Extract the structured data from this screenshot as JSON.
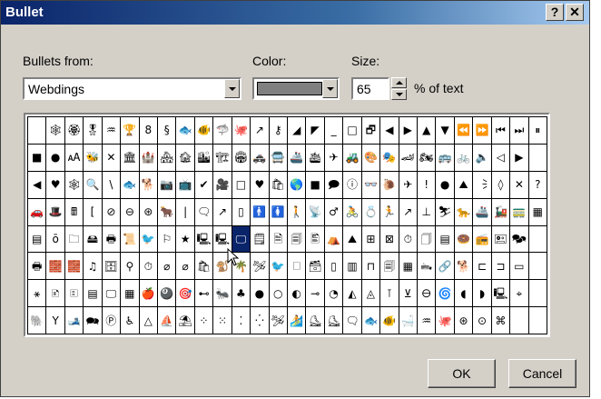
{
  "window": {
    "title": "Bullet",
    "help_label": "?",
    "close_label": "✕"
  },
  "bullets_from": {
    "label": "Bullets from:",
    "value": "Webdings"
  },
  "color": {
    "label": "Color:",
    "value": "#808080"
  },
  "size": {
    "label": "Size:",
    "value": "65",
    "suffix": "% of text"
  },
  "grid": {
    "selected_row": 4,
    "selected_col": 11,
    "rows": [
      [
        "",
        "🕸",
        "🏵",
        "🎖",
        "♒",
        "🏆",
        "8",
        "§",
        "🐟",
        "🐠",
        "🦈",
        "🐙",
        "↗",
        "⚷",
        "◢",
        "◤",
        "_",
        "□",
        "🗗",
        "◀",
        "▶",
        "▲",
        "▼",
        "⏪",
        "⏩",
        "⏮",
        "⏭",
        "⏸"
      ],
      [
        "■",
        "●",
        "🗚",
        "🐝",
        "✕",
        "🏛",
        "🏰",
        "🏘",
        "🏚",
        "🏙",
        "🏗",
        "🏟",
        "🚓",
        "🚍",
        "🚢",
        "🛳",
        "✈",
        "🚜",
        "🎨",
        "🎭",
        "🏎",
        "🏍",
        "🚌",
        "🚲",
        "🔈",
        "◁",
        "▶"
      ],
      [
        "◀",
        "♥",
        "🕸",
        "🔍",
        "\\",
        "🐟",
        "🐕",
        "📷",
        "📺",
        "✔",
        "🎥",
        "□",
        "♥",
        "🛍",
        "🌎",
        "■",
        "🗩",
        "ⓘ",
        "👓",
        "🐌",
        "✈",
        "!",
        "●",
        "⛰",
        "🗦",
        "◊",
        "✕",
        "?"
      ],
      [
        "🚗",
        "🎩",
        "🖩",
        "[",
        "⊘",
        "⊖",
        "⊛",
        "🐂",
        "|",
        "🗨",
        "↗",
        "▯",
        "🚹",
        "🚺",
        "🚶",
        "📡",
        "♂",
        "🚴",
        "💍",
        "🏃",
        "↗",
        "⊥",
        "⛷",
        "🐆",
        "🚢",
        "🚂",
        "🚃",
        "▦"
      ],
      [
        "▤",
        "ō",
        "🗀",
        "🖴",
        "🖶",
        "📜",
        "🐦",
        "⚐",
        "★",
        "🖳",
        "🖳",
        "🖵",
        "🗒",
        "🗎",
        "🗐",
        "🖺",
        "⛺",
        "⛰",
        "⊞",
        "⊠",
        "⏱",
        "🗍",
        "▤",
        "🍩",
        "📻",
        "🖭",
        "🗫"
      ],
      [
        "🖶",
        "🧱",
        "🧱",
        "♫",
        "🗄",
        "⚲",
        "⏱",
        "⌀",
        "⌀",
        "🛍",
        "🐒",
        "🌴",
        "🛩",
        "🐦",
        "🗆",
        "🗃",
        "▯",
        "▥",
        "⊓",
        "🗐",
        "▦",
        "🖦",
        "🔗",
        "🐕",
        "⊏",
        "⊐",
        "▭"
      ],
      [
        "⚹",
        "🗈",
        "🗉",
        "▤",
        "🖵",
        "▦",
        "🍎",
        "🎱",
        "🎯",
        "⊷",
        "🐜",
        "♣",
        "●",
        "○",
        "◐",
        "⊸",
        "◔",
        "◭",
        "◬",
        "⊺",
        "⊻",
        "🜔",
        "🌀",
        "◖",
        "◗",
        "🖳",
        "⌖"
      ],
      [
        "🐘",
        "Υ",
        "🎿",
        "🗪",
        "Ⓟ",
        "♿",
        "△",
        "⛵",
        "⛱",
        "⁘",
        "⁙",
        "⁚",
        "⁛",
        "🛩",
        "🏄",
        "⛸",
        "⛸",
        "🗨",
        "🐟",
        "🐠",
        "🛁",
        "♒",
        "🐙",
        "⊛",
        "⊙",
        "⌘"
      ]
    ]
  },
  "buttons": {
    "ok": "OK",
    "cancel": "Cancel"
  }
}
